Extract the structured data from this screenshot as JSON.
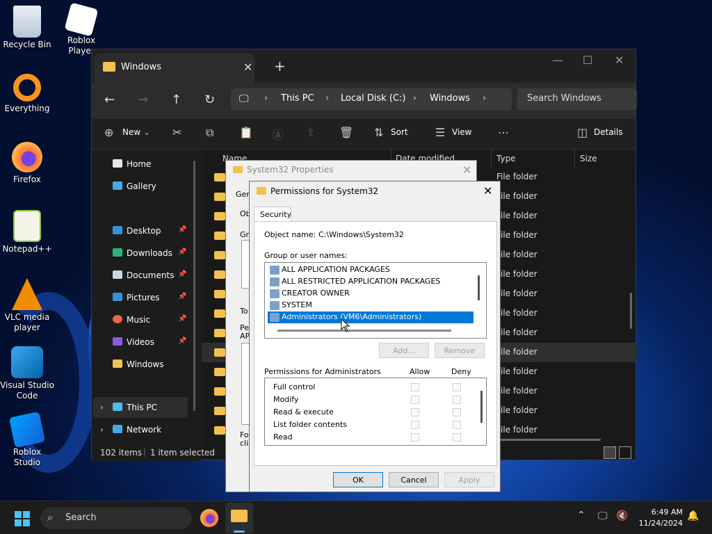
{
  "desktop": {
    "icons": [
      {
        "label": "Recycle Bin",
        "icon": "recycle-bin-icon"
      },
      {
        "label": "Roblox Player",
        "icon": "roblox-player-icon"
      },
      {
        "label": "Everything",
        "icon": "everything-search-icon"
      },
      {
        "label": "Firefox",
        "icon": "firefox-icon"
      },
      {
        "label": "Notepad++",
        "icon": "notepad-plus-plus-icon"
      },
      {
        "label": "VLC media player",
        "icon": "vlc-icon"
      },
      {
        "label": "Visual Studio Code",
        "icon": "vscode-icon"
      },
      {
        "label": "Roblox Studio",
        "icon": "roblox-studio-icon"
      }
    ]
  },
  "explorer": {
    "tab_title": "Windows",
    "breadcrumb": [
      "This PC",
      "Local Disk (C:)",
      "Windows"
    ],
    "search_placeholder": "Search Windows",
    "commands": {
      "new": "New",
      "sort": "Sort",
      "view": "View",
      "details": "Details"
    },
    "nav": {
      "home": "Home",
      "gallery": "Gallery",
      "desktop": "Desktop",
      "downloads": "Downloads",
      "documents": "Documents",
      "pictures": "Pictures",
      "music": "Music",
      "videos": "Videos",
      "windows": "Windows",
      "this_pc": "This PC",
      "network": "Network"
    },
    "columns": {
      "name": "Name",
      "date_modified": "Date modified",
      "type": "Type",
      "size": "Size"
    },
    "rows": [
      {
        "type": "File folder"
      },
      {
        "type": "File folder"
      },
      {
        "type": "File folder"
      },
      {
        "type": "File folder"
      },
      {
        "type": "File folder"
      },
      {
        "type": "File folder"
      },
      {
        "type": "File folder"
      },
      {
        "type": "File folder"
      },
      {
        "type": "File folder"
      },
      {
        "type": "File folder"
      },
      {
        "type": "File folder"
      },
      {
        "type": "File folder"
      },
      {
        "type": "File folder"
      },
      {
        "type": "File folder"
      }
    ],
    "status": {
      "items": "102 items",
      "selected": "1 item selected"
    }
  },
  "properties_dialog": {
    "title": "System32 Properties",
    "peek_labels": [
      "Gen",
      "Ob",
      "Gr",
      "To",
      "Pe",
      "AP",
      "Fo",
      "clic"
    ]
  },
  "permissions_dialog": {
    "title": "Permissions for System32",
    "tab": "Security",
    "object_label": "Object name:",
    "object_value": "C:\\Windows\\System32",
    "group_label": "Group or user names:",
    "users": [
      "ALL APPLICATION PACKAGES",
      "ALL RESTRICTED APPLICATION PACKAGES",
      "CREATOR OWNER",
      "SYSTEM",
      "Administrators (VM6\\Administrators)"
    ],
    "add": "Add...",
    "remove": "Remove",
    "perm_label": "Permissions for Administrators",
    "allow": "Allow",
    "deny": "Deny",
    "permissions": [
      "Full control",
      "Modify",
      "Read & execute",
      "List folder contents",
      "Read"
    ],
    "ok": "OK",
    "cancel": "Cancel",
    "apply": "Apply"
  },
  "taskbar": {
    "search": "Search",
    "time": "6:49 AM",
    "date": "11/24/2024"
  }
}
